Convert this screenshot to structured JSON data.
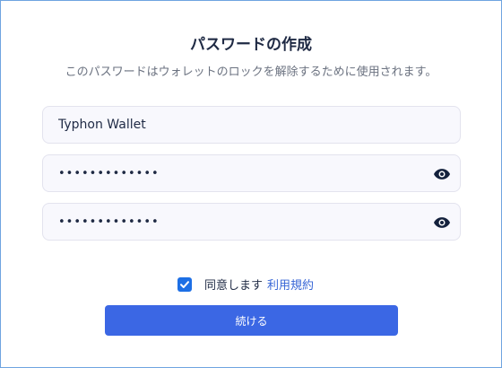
{
  "header": {
    "title": "パスワードの作成",
    "subtitle": "このパスワードはウォレットのロックを解除するために使用されます。"
  },
  "form": {
    "wallet_name": {
      "value": "Typhon Wallet"
    },
    "password": {
      "value": "•••••••••••••",
      "icon": "eye-icon"
    },
    "confirm_password": {
      "value": "•••••••••••••",
      "icon": "eye-icon"
    }
  },
  "agreement": {
    "checked": true,
    "label": "同意します",
    "link": "利用規約"
  },
  "actions": {
    "continue_label": "続ける"
  },
  "colors": {
    "accent": "#3b67e4",
    "link": "#3866d6",
    "checkbox": "#1d6fe5",
    "field_bg": "#f8f8fd"
  }
}
